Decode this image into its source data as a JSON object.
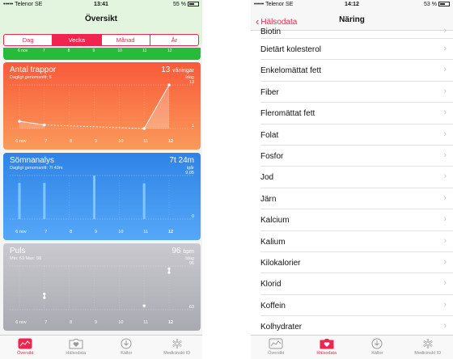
{
  "left": {
    "status": {
      "carrier": "••••• Telenor SE",
      "time": "13:41",
      "battery": "55 %"
    },
    "title": "Översikt",
    "segments": [
      {
        "label": "Dag",
        "selected": false
      },
      {
        "label": "Vecka",
        "selected": true
      },
      {
        "label": "Månad",
        "selected": false
      },
      {
        "label": "År",
        "selected": false
      }
    ],
    "top_strip_axis": [
      "6 nov",
      "7",
      "8",
      "9",
      "10",
      "11",
      "12"
    ],
    "cards": [
      {
        "title": "Antal trappor",
        "subtitle": "Dagligt genomsnitt: 5",
        "value": "13",
        "unit": "våningar",
        "value_sub": "Idag",
        "color": "#f95a3a",
        "axis_top": "13",
        "axis_bottom": "1",
        "chart_data": {
          "type": "line",
          "x": [
            "6 nov",
            "7",
            "8",
            "9",
            "10",
            "11",
            "12"
          ],
          "values": [
            3,
            2,
            null,
            null,
            null,
            1,
            13
          ],
          "ylim": [
            1,
            13
          ]
        }
      },
      {
        "title": "Sömnanalys",
        "subtitle": "Dagligt genomsnitt: 7t 43m",
        "value": "7t 24m",
        "unit": "",
        "value_sub": "Igår",
        "color": "#2f83e6",
        "axis_top": "9,05",
        "axis_bottom": "0",
        "chart_data": {
          "type": "bar",
          "x": [
            "6 nov",
            "7",
            "8",
            "9",
            "10",
            "11",
            "12"
          ],
          "values": [
            7.5,
            7.5,
            null,
            9,
            null,
            7.4,
            null
          ],
          "ylim": [
            0,
            9.05
          ]
        }
      },
      {
        "title": "Puls",
        "subtitle": "Min: 63  Max: 96",
        "value": "96",
        "unit": "bpm",
        "value_sub": "Idag",
        "color": "#b9b9c0",
        "axis_top": "96",
        "axis_bottom": "63",
        "chart_data": {
          "type": "scatter",
          "x": [
            "6 nov",
            "7",
            "8",
            "9",
            "10",
            "11",
            "12"
          ],
          "ranges": [
            null,
            [
              72,
              75
            ],
            null,
            null,
            null,
            [
              66,
              66
            ],
            [
              91,
              94
            ]
          ],
          "ylim": [
            63,
            96
          ]
        }
      }
    ],
    "tabs": [
      {
        "label": "Översikt",
        "icon": "overview-icon",
        "active": true
      },
      {
        "label": "Hälsodata",
        "icon": "health-data-icon",
        "active": false
      },
      {
        "label": "Källor",
        "icon": "sources-icon",
        "active": false
      },
      {
        "label": "Medicinskt ID",
        "icon": "medical-id-icon",
        "active": false
      }
    ]
  },
  "right": {
    "status": {
      "carrier": "••••• Telenor SE",
      "time": "14:12",
      "battery": "53 %"
    },
    "back_label": "Hälsodata",
    "title": "Näring",
    "items": [
      "Biotin",
      "Dietärt kolesterol",
      "Enkelomättat fett",
      "Fiber",
      "Fleromättat fett",
      "Folat",
      "Fosfor",
      "Jod",
      "Järn",
      "Kalcium",
      "Kalium",
      "Kilokalorier",
      "Klorid",
      "Koffein",
      "Kolhydrater"
    ],
    "tabs": [
      {
        "label": "Översikt",
        "icon": "overview-icon",
        "active": false
      },
      {
        "label": "Hälsodata",
        "icon": "health-data-icon",
        "active": true
      },
      {
        "label": "Källor",
        "icon": "sources-icon",
        "active": false
      },
      {
        "label": "Medicinskt ID",
        "icon": "medical-id-icon",
        "active": false
      }
    ]
  }
}
